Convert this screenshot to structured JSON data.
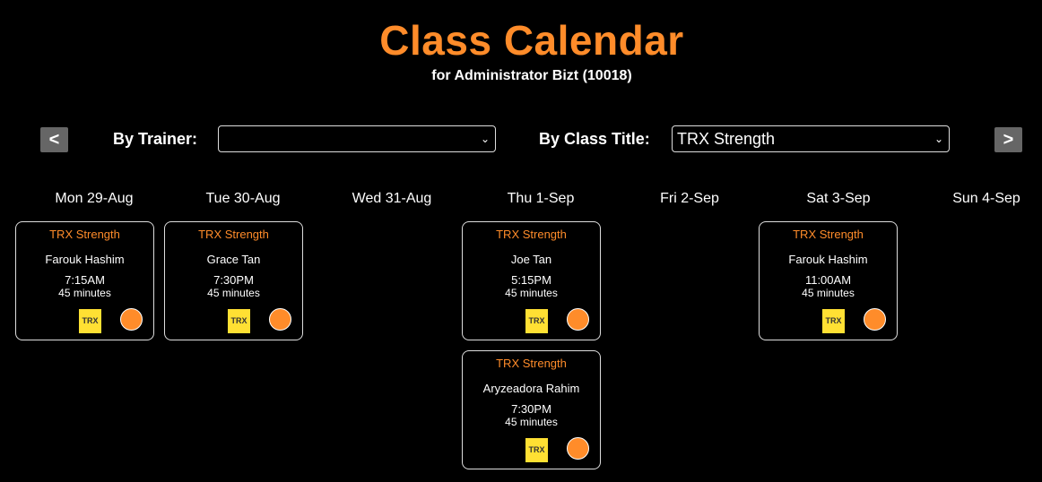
{
  "header": {
    "title": "Class Calendar",
    "subtitle": "for Administrator Bizt (10018)"
  },
  "nav": {
    "prev_label": "<",
    "next_label": ">"
  },
  "filters": {
    "trainer_label": "By Trainer:",
    "trainer_value": "",
    "class_label": "By Class Title:",
    "class_value": "TRX Strength"
  },
  "days": [
    "Mon 29-Aug",
    "Tue 30-Aug",
    "Wed 31-Aug",
    "Thu 1-Sep",
    "Fri 2-Sep",
    "Sat 3-Sep",
    "Sun 4-Sep"
  ],
  "cards": [
    {
      "title": "TRX Strength",
      "trainer": "Farouk Hashim",
      "time": "7:15AM",
      "duration": "45 minutes",
      "badge": "TRX"
    },
    {
      "title": "TRX Strength",
      "trainer": "Grace Tan",
      "time": "7:30PM",
      "duration": "45 minutes",
      "badge": "TRX"
    },
    {
      "title": "TRX Strength",
      "trainer": "Joe Tan",
      "time": "5:15PM",
      "duration": "45 minutes",
      "badge": "TRX"
    },
    {
      "title": "TRX Strength",
      "trainer": "Farouk Hashim",
      "time": "11:00AM",
      "duration": "45 minutes",
      "badge": "TRX"
    },
    {
      "title": "TRX Strength",
      "trainer": "Aryzeadora Rahim",
      "time": "7:30PM",
      "duration": "45 minutes",
      "badge": "TRX"
    }
  ],
  "colors": {
    "accent": "#ff8c2a",
    "badge": "#ffe033",
    "background": "#000000"
  },
  "icons": {
    "dropdown": "chevron-down-icon",
    "status": "status-dot-icon"
  }
}
